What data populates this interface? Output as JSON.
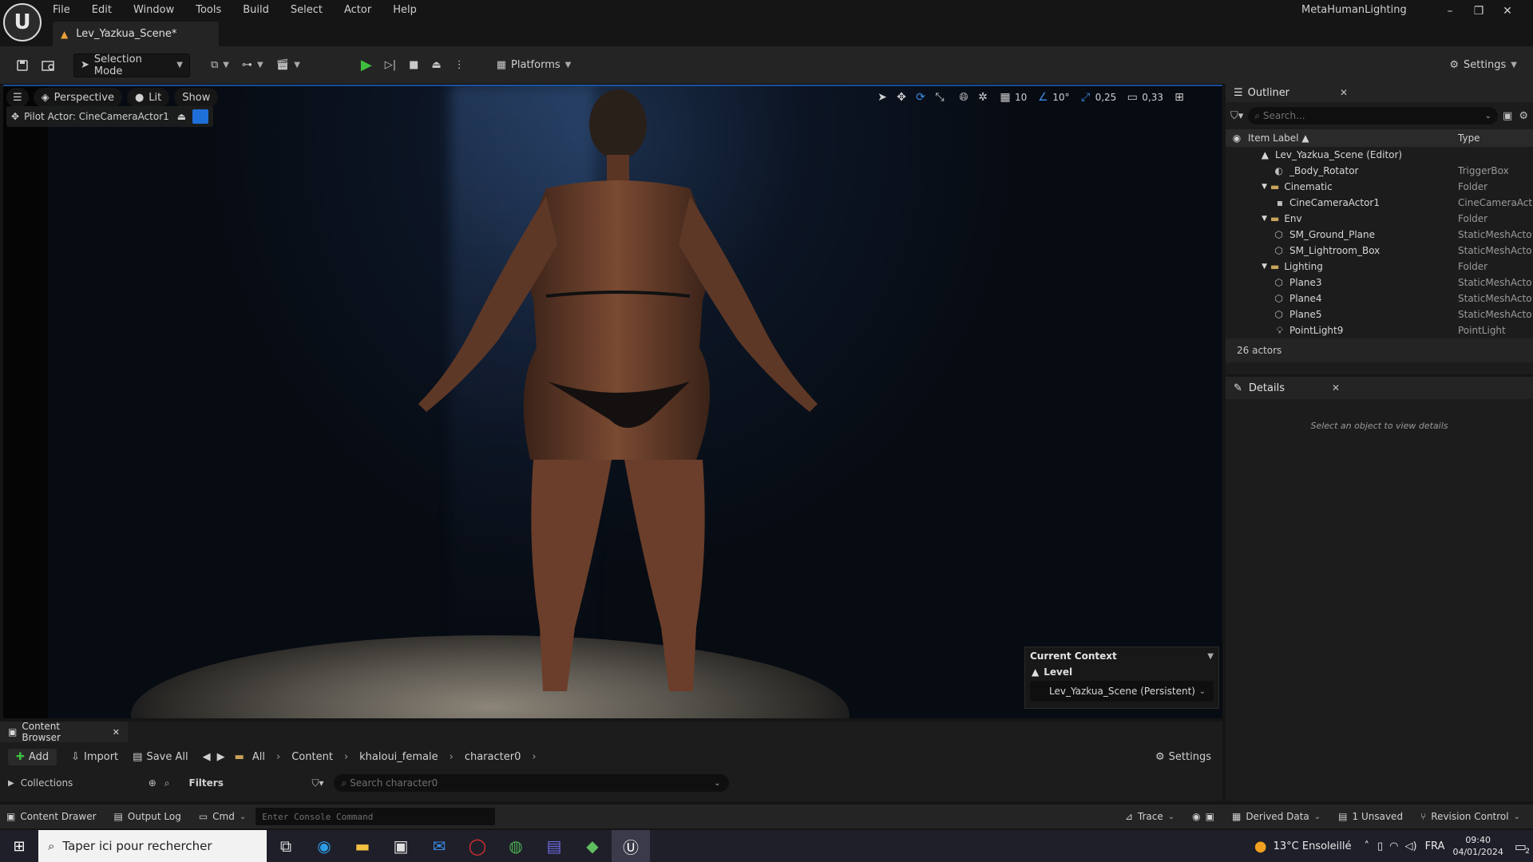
{
  "menu": [
    "File",
    "Edit",
    "Window",
    "Tools",
    "Build",
    "Select",
    "Actor",
    "Help"
  ],
  "document_tab": "Lev_Yazkua_Scene*",
  "project_name": "MetaHumanLighting",
  "toolbar": {
    "selection_mode": "Selection Mode",
    "platforms": "Platforms",
    "settings": "Settings"
  },
  "viewport": {
    "perspective": "Perspective",
    "lit": "Lit",
    "show": "Show",
    "pilot_actor": "Pilot Actor: CineCameraActor1",
    "grid_size": "10",
    "rotation_snap": "10°",
    "scale_snap": "0,25",
    "camera_speed": "0,33"
  },
  "context": {
    "title": "Current Context",
    "level_label": "Level",
    "level_value": "Lev_Yazkua_Scene (Persistent)"
  },
  "outliner": {
    "tab": "Outliner",
    "search_placeholder": "Search...",
    "col_label": "Item Label ▲",
    "col_type": "Type",
    "rows": [
      {
        "label": "Lev_Yazkua_Scene (Editor)",
        "type": ""
      },
      {
        "label": "_Body_Rotator",
        "type": "TriggerBox"
      },
      {
        "label": "Cinematic",
        "type": "Folder"
      },
      {
        "label": "CineCameraActor1",
        "type": "CineCameraAct"
      },
      {
        "label": "Env",
        "type": "Folder"
      },
      {
        "label": "SM_Ground_Plane",
        "type": "StaticMeshActo"
      },
      {
        "label": "SM_Lightroom_Box",
        "type": "StaticMeshActo"
      },
      {
        "label": "Lighting",
        "type": "Folder"
      },
      {
        "label": "Plane3",
        "type": "StaticMeshActo"
      },
      {
        "label": "Plane4",
        "type": "StaticMeshActo"
      },
      {
        "label": "Plane5",
        "type": "StaticMeshActo"
      },
      {
        "label": "PointLight9",
        "type": "PointLight"
      }
    ],
    "actor_count": "26 actors"
  },
  "details": {
    "tab": "Details",
    "empty": "Select an object to view details"
  },
  "content_browser": {
    "tab": "Content Browser",
    "add": "Add",
    "import": "Import",
    "save_all": "Save All",
    "breadcrumbs": [
      "All",
      "Content",
      "khaloui_female",
      "character0"
    ],
    "settings": "Settings",
    "collections": "Collections",
    "filters": "Filters",
    "search_placeholder": "Search character0"
  },
  "statusbar": {
    "content_drawer": "Content Drawer",
    "output_log": "Output Log",
    "cmd": "Cmd",
    "console_placeholder": "Enter Console Command",
    "trace": "Trace",
    "derived_data": "Derived Data",
    "unsaved": "1 Unsaved",
    "revision_control": "Revision Control"
  },
  "taskbar": {
    "search": "Taper ici pour rechercher",
    "weather": "13°C Ensoleillé",
    "language": "FRA",
    "time": "09:40",
    "date": "04/01/2024",
    "notifications": "2"
  }
}
